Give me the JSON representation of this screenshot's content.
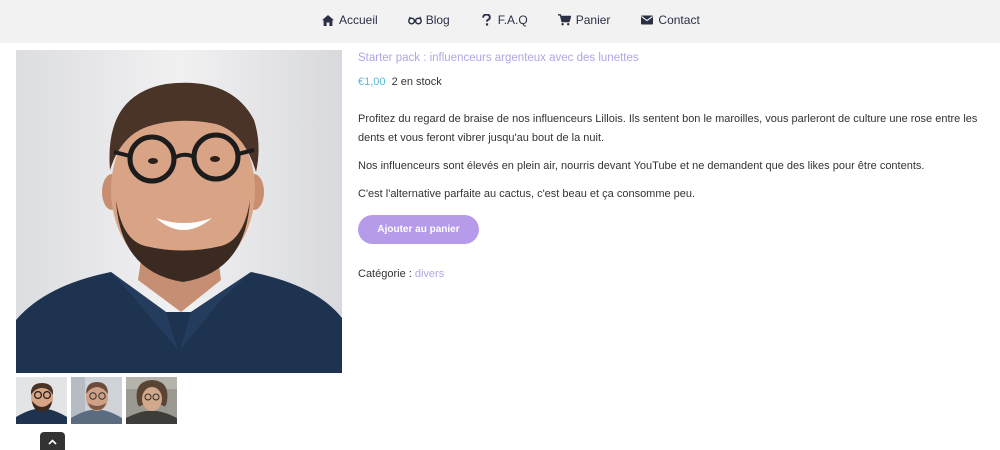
{
  "nav": {
    "items": [
      {
        "label": "Accueil",
        "icon": "home-icon"
      },
      {
        "label": "Blog",
        "icon": "glasses-icon"
      },
      {
        "label": "F.A.Q",
        "icon": "question-icon"
      },
      {
        "label": "Panier",
        "icon": "cart-icon"
      },
      {
        "label": "Contact",
        "icon": "envelope-icon"
      }
    ]
  },
  "product": {
    "title": "Starter pack : influenceurs argenteux avec des lunettes",
    "price": "€1,00",
    "stock": "2 en stock",
    "description": [
      "Profitez du regard de braise de nos influenceurs Lillois. Ils sentent bon le maroilles, vous parleront de culture une rose entre les dents et vous feront vibrer jusqu'au bout de la nuit.",
      "Nos influenceurs sont élevés en plein air, nourris devant YouTube et ne demandent que des likes pour être contents.",
      "C'est l'alternative parfaite au cactus, c'est beau et ça consomme peu."
    ],
    "add_to_cart_label": "Ajouter au panier",
    "category_label": "Catégorie :",
    "category_value": "divers"
  },
  "colors": {
    "accent": "#b59be9",
    "link": "#b2a4e6",
    "price": "#58b9d6",
    "nav_bg": "#f2f2f2"
  }
}
